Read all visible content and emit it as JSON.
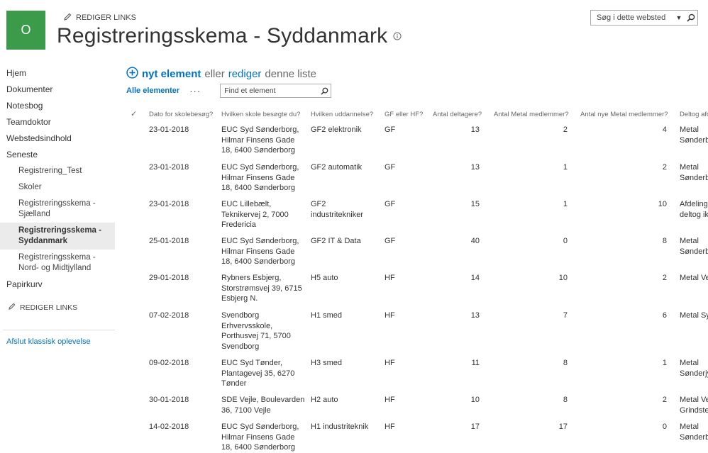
{
  "header": {
    "logo_letter": "O",
    "edit_links": "REDIGER LINKS",
    "site_title": "Registreringsskema - Syddanmark",
    "search_placeholder": "Søg i dette websted"
  },
  "leftnav": {
    "items": [
      "Hjem",
      "Dokumenter",
      "Notesbog",
      "Teamdoktor",
      "Webstedsindhold",
      "Seneste"
    ],
    "recent": [
      "Registrering_Test",
      "Skoler",
      "Registreringsskema - Sjælland",
      "Registreringsskema - Syddanmark",
      "Registreringsskema - Nord- og Midtjylland"
    ],
    "recent_selected_index": 3,
    "trash": "Papirkurv",
    "edit_links": "REDIGER LINKS",
    "exit_classic": "Afslut klassisk oplevelse"
  },
  "list": {
    "new_item": "nyt element",
    "or": "eller",
    "edit": "rediger",
    "this_list": "denne liste",
    "view_all": "Alle elementer",
    "more": "···",
    "find_placeholder": "Find et element",
    "columns": [
      "✓",
      "Dato for skolebesøg?",
      "Hvilken skole besøgte du?",
      "Hvilken uddannelse?",
      "GF eller HF?",
      "Antal deltagere?",
      "Antal Metal medlemmer?",
      "Antal nye Metal medlemmer?",
      "Deltog afdelingen?"
    ],
    "rows": [
      {
        "date": "23-01-2018",
        "school": "EUC Syd Sønderborg,\nHilmar Finsens Gade\n18, 6400 Sønderborg",
        "edu": "GF2 elektronik",
        "gf": "GF",
        "participants": "13",
        "members": "2",
        "new_members": "4",
        "dept": "Metal\nSønderborg"
      },
      {
        "date": "23-01-2018",
        "school": "EUC Syd Sønderborg,\nHilmar Finsens Gade\n18, 6400 Sønderborg",
        "edu": "GF2 automatik",
        "gf": "GF",
        "participants": "13",
        "members": "1",
        "new_members": "2",
        "dept": "Metal\nSønderborg"
      },
      {
        "date": "23-01-2018",
        "school": "EUC Lillebælt,\nTeknikervej 2, 7000\nFredericia",
        "edu": "GF2\nindustritekniker",
        "gf": "GF",
        "participants": "15",
        "members": "1",
        "new_members": "10",
        "dept": "Afdelingen\ndeltog ikke"
      },
      {
        "date": "25-01-2018",
        "school": "EUC Syd Sønderborg,\nHilmar Finsens Gade\n18, 6400 Sønderborg",
        "edu": "GF2 IT & Data",
        "gf": "GF",
        "participants": "40",
        "members": "0",
        "new_members": "8",
        "dept": "Metal\nSønderborg"
      },
      {
        "date": "29-01-2018",
        "school": "Rybners Esbjerg,\nStorstrømsvej 39, 6715\nEsbjerg N.",
        "edu": "H5 auto",
        "gf": "HF",
        "participants": "14",
        "members": "10",
        "new_members": "2",
        "dept": "Metal Vestjylland"
      },
      {
        "date": "07-02-2018",
        "school": "Svendborg\nErhvervsskole,\nPorthusvej 71, 5700\nSvendborg",
        "edu": "H1 smed",
        "gf": "HF",
        "participants": "13",
        "members": "7",
        "new_members": "6",
        "dept": "Metal Sydfyn"
      },
      {
        "date": "09-02-2018",
        "school": "EUC Syd Tønder,\nPlantagevej 35, 6270\nTønder",
        "edu": "H3 smed",
        "gf": "HF",
        "participants": "11",
        "members": "8",
        "new_members": "1",
        "dept": "Metal\nSønderjylland"
      },
      {
        "date": "30-01-2018",
        "school": "SDE Vejle, Boulevarden\n36, 7100 Vejle",
        "edu": "H2 auto",
        "gf": "HF",
        "participants": "10",
        "members": "8",
        "new_members": "2",
        "dept": "Metal Vejle\nGrindsted"
      },
      {
        "date": "14-02-2018",
        "school": "EUC Syd Sønderborg,\nHilmar Finsens Gade\n18, 6400 Sønderborg",
        "edu": "H1 industriteknik",
        "gf": "HF",
        "participants": "17",
        "members": "17",
        "new_members": "0",
        "dept": "Metal\nSønderborg"
      }
    ]
  },
  "colors": {
    "logo": "#3b9b4b",
    "link": "#0072c6",
    "selected_nav": "#ebebeb"
  }
}
